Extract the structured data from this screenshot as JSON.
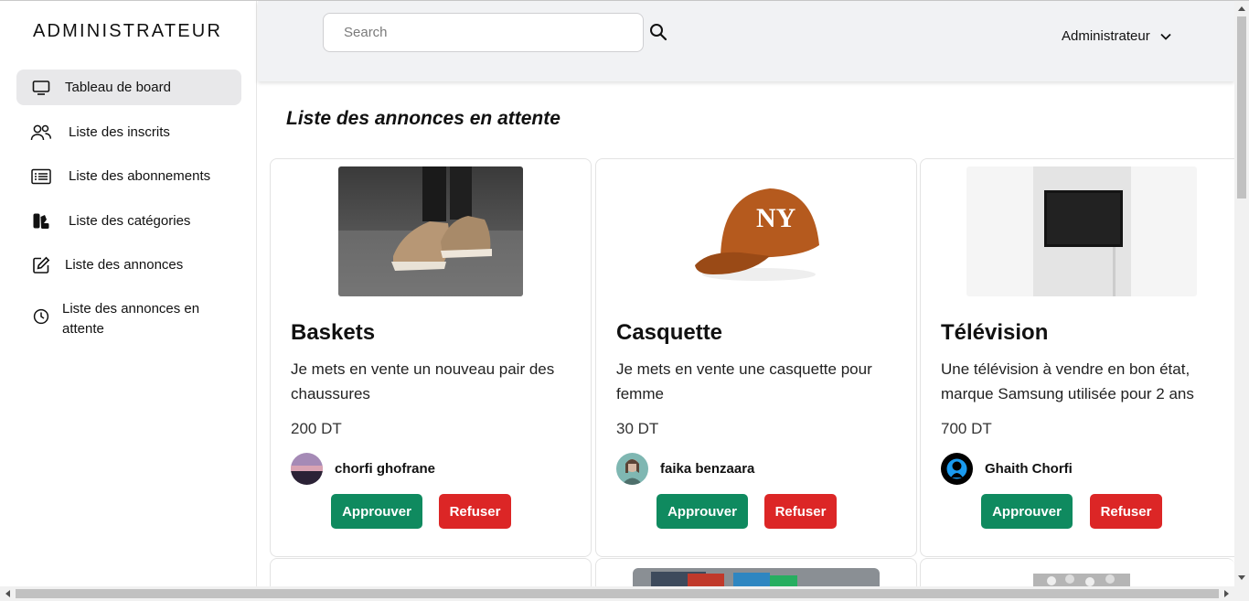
{
  "sidebar": {
    "brand": "ADMINISTRATEUR",
    "items": [
      {
        "label": "Tableau de board",
        "icon": "monitor-icon",
        "active": true
      },
      {
        "label": "Liste des inscrits",
        "icon": "users-icon"
      },
      {
        "label": "Liste des abonnements",
        "icon": "list-icon"
      },
      {
        "label": "Liste des catégories",
        "icon": "category-icon"
      },
      {
        "label": "Liste des annonces",
        "icon": "edit-icon"
      },
      {
        "label": "Liste des annonces en attente",
        "icon": "clock-icon"
      }
    ]
  },
  "header": {
    "search_placeholder": "Search",
    "user_label": "Administrateur"
  },
  "main": {
    "title": "Liste des annonces en attente",
    "cards": [
      {
        "title": "Baskets",
        "description": "Je mets en vente un nouveau pair des chaussures",
        "price": "200 DT",
        "seller": "chorfi ghofrane",
        "approve_label": "Approuver",
        "refuse_label": "Refuser"
      },
      {
        "title": "Casquette",
        "description": "Je mets en vente une casquette pour femme",
        "price": "30 DT",
        "seller": "faika benzaara",
        "approve_label": "Approuver",
        "refuse_label": "Refuser"
      },
      {
        "title": "Télévision",
        "description": "Une télévision à vendre en bon état, marque Samsung utilisée pour 2 ans",
        "price": "700 DT",
        "seller": "Ghaith Chorfi",
        "approve_label": "Approuver",
        "refuse_label": "Refuser"
      }
    ]
  },
  "colors": {
    "approve": "#0f8a5f",
    "refuse": "#dc2626",
    "header_bg": "#f1f2f4",
    "active_nav": "#e8e8ea"
  }
}
